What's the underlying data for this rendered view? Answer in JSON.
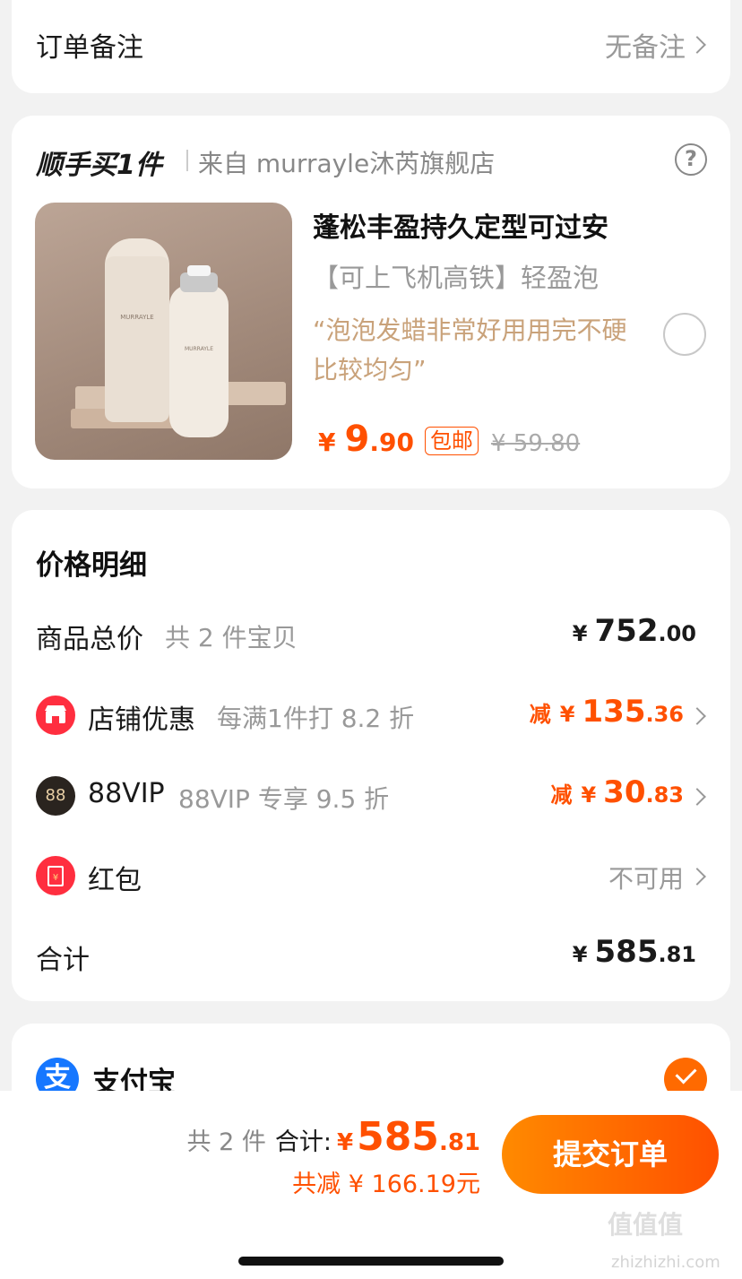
{
  "order_note": {
    "label": "订单备注",
    "value": "无备注"
  },
  "addon": {
    "title": "顺手买1件",
    "shop": "来自 murrayle沐芮旗舰店",
    "help_icon": "question-circle-icon",
    "product": {
      "image_brand": "MURRAYLE",
      "title": "蓬松丰盈持久定型可过安",
      "subtitle": "【可上飞机高铁】轻盈泡",
      "review": "“泡泡发蜡非常好用用完不硬比较均匀”",
      "currency": "¥",
      "price_int": "9",
      "price_dec": ".90",
      "tag": "包邮",
      "original_price": "¥ 59.80",
      "selected": false
    }
  },
  "price_detail": {
    "title": "价格明细",
    "goods_total": {
      "label": "商品总价",
      "hint": "共 2 件宝贝",
      "currency": "¥",
      "int": "752",
      "dec": ".00"
    },
    "store_discount": {
      "label": "店铺优惠",
      "hint": "每满1件打 8.2 折",
      "prefix": "减",
      "currency": "¥",
      "int": "135",
      "dec": ".36",
      "icon": "store-icon"
    },
    "vip": {
      "label": "88VIP",
      "hint": "88VIP 专享 9.5 折",
      "prefix": "减",
      "currency": "¥",
      "int": "30",
      "dec": ".83",
      "icon_text": "88"
    },
    "red_packet": {
      "label": "红包",
      "value": "不可用",
      "icon": "red-packet-icon"
    },
    "total": {
      "label": "合计",
      "currency": "¥",
      "int": "585",
      "dec": ".81"
    }
  },
  "payment": {
    "label": "支付宝",
    "icon_text": "支",
    "selected": true
  },
  "bottom_bar": {
    "count": "共 2 件",
    "total_label": "合计:",
    "currency": "¥",
    "total_int": "585",
    "total_dec": ".81",
    "saved": "共减 ¥ 166.19元",
    "submit_label": "提交订单"
  },
  "watermark": {
    "text": "值值值",
    "sub": "zhizhizhi.com"
  },
  "colors": {
    "accent": "#ff5000",
    "review": "#c9a27a",
    "alipay": "#1677ff"
  }
}
